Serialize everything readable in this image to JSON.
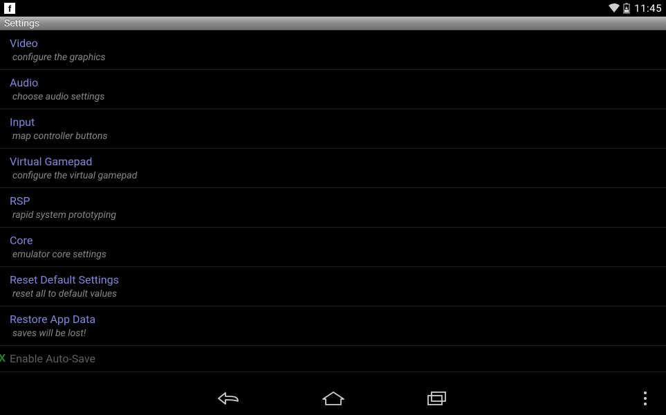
{
  "status_bar": {
    "notification_app": "f",
    "clock": "11:45"
  },
  "title_bar": {
    "title": "Settings"
  },
  "settings": [
    {
      "title": "Video",
      "subtitle": "configure the graphics"
    },
    {
      "title": "Audio",
      "subtitle": "choose audio settings"
    },
    {
      "title": "Input",
      "subtitle": "map controller buttons"
    },
    {
      "title": "Virtual Gamepad",
      "subtitle": "configure the virtual gamepad"
    },
    {
      "title": "RSP",
      "subtitle": "rapid system prototyping"
    },
    {
      "title": "Core",
      "subtitle": "emulator core settings"
    },
    {
      "title": "Reset Default Settings",
      "subtitle": "reset all to default values"
    },
    {
      "title": "Restore App Data",
      "subtitle": "saves will be lost!"
    },
    {
      "title": "Enable Auto-Save",
      "subtitle": "",
      "partial": true,
      "checked": true
    }
  ]
}
